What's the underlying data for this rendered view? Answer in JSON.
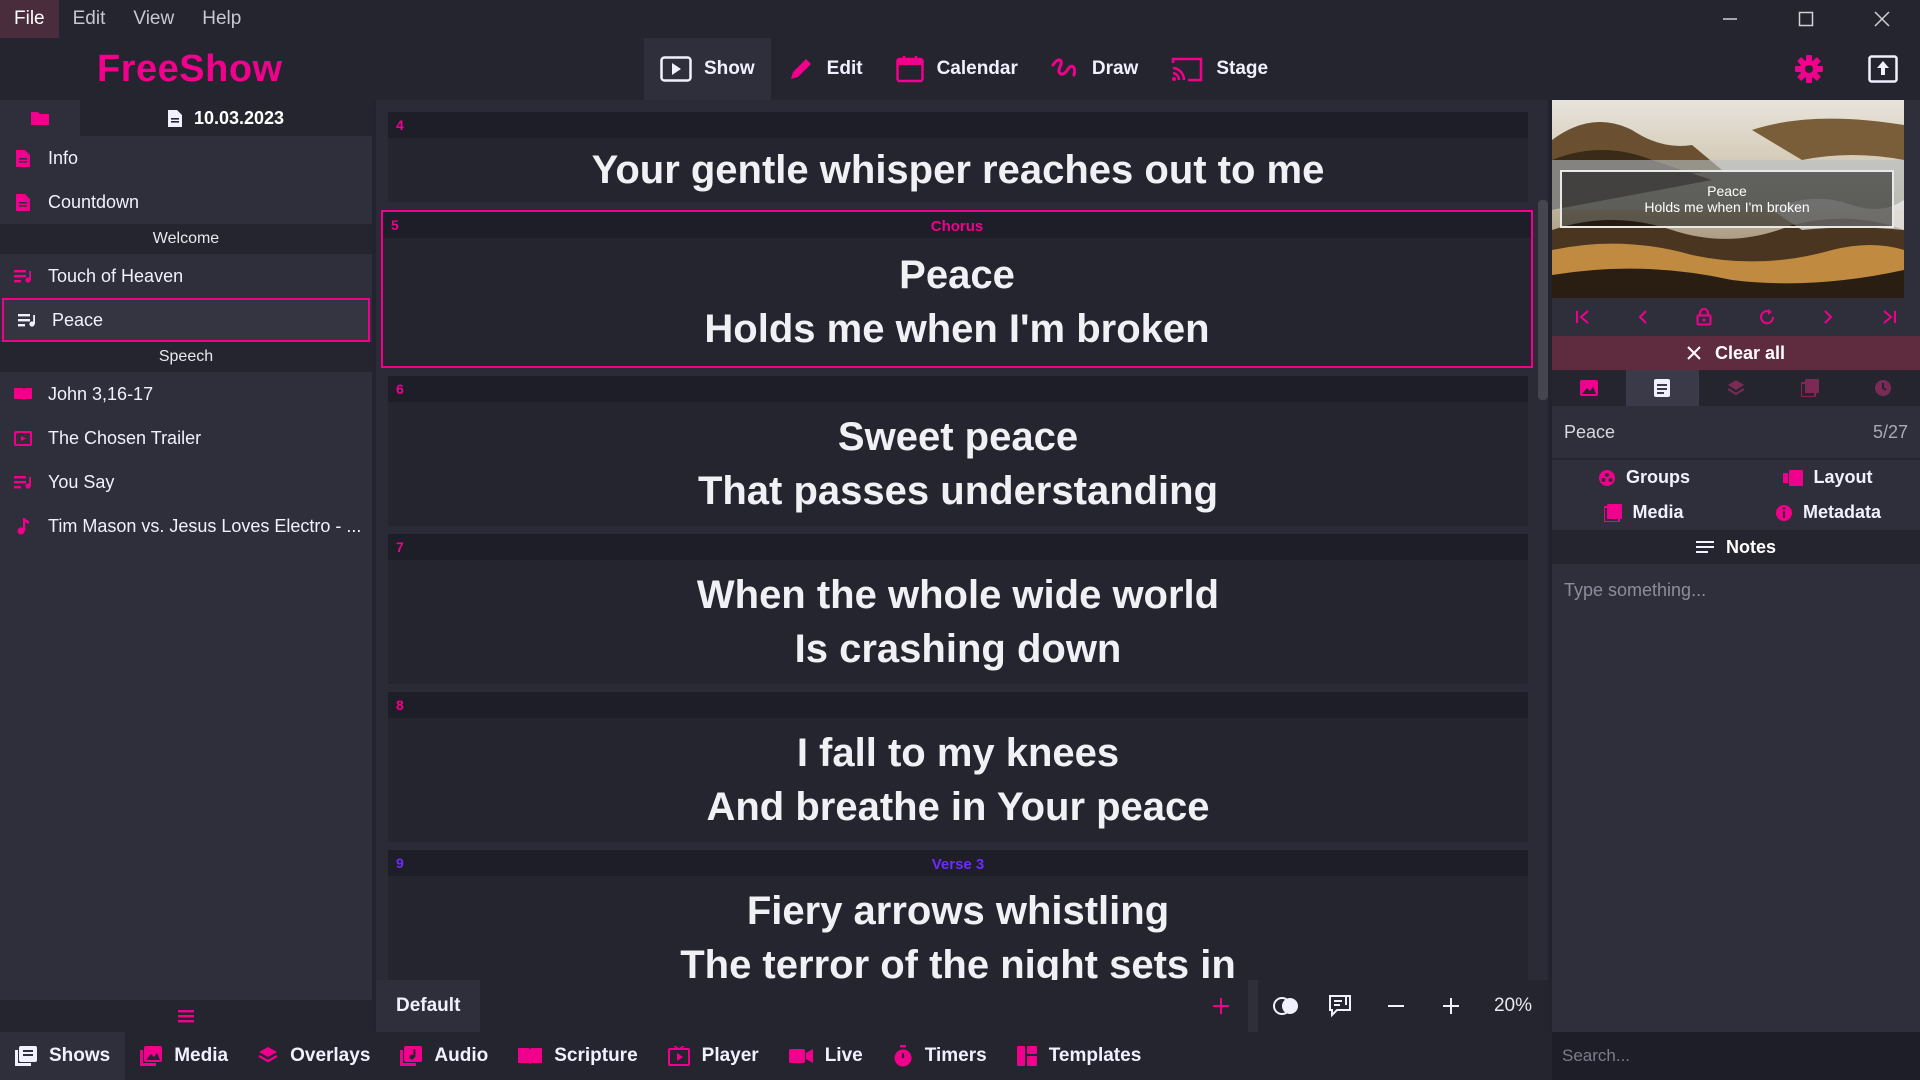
{
  "menu": [
    "File",
    "Edit",
    "View",
    "Help"
  ],
  "app": {
    "title": "FreeShow"
  },
  "colors": {
    "accent": "#f0008c",
    "verse": "#6c2bff"
  },
  "topnav": [
    {
      "label": "Show",
      "icon": "play-icon"
    },
    {
      "label": "Edit",
      "icon": "pencil-icon"
    },
    {
      "label": "Calendar",
      "icon": "calendar-icon"
    },
    {
      "label": "Draw",
      "icon": "draw-icon"
    },
    {
      "label": "Stage",
      "icon": "cast-icon"
    }
  ],
  "projects": {
    "date": "10.03.2023",
    "items": [
      {
        "label": "Info",
        "icon": "document-icon"
      },
      {
        "label": "Countdown",
        "icon": "document-icon"
      }
    ],
    "section1": "Welcome",
    "items2": [
      {
        "label": "Touch of Heaven",
        "icon": "lyrics-icon"
      },
      {
        "label": "Peace",
        "icon": "lyrics-icon"
      }
    ],
    "section2": "Speech",
    "items3": [
      {
        "label": "John 3,16-17",
        "icon": "book-icon"
      },
      {
        "label": "The Chosen Trailer",
        "icon": "video-icon"
      },
      {
        "label": "You Say",
        "icon": "lyrics-icon"
      },
      {
        "label": "Tim Mason vs. Jesus Loves Electro - ...",
        "icon": "music-icon"
      }
    ]
  },
  "slides": [
    {
      "num": "4",
      "group": "",
      "lines": [
        "Your gentle whisper reaches out to me"
      ]
    },
    {
      "num": "5",
      "group": "Chorus",
      "lines": [
        "Peace",
        "Holds me when I'm broken"
      ]
    },
    {
      "num": "6",
      "group": "",
      "lines": [
        "Sweet peace",
        "That passes understanding"
      ]
    },
    {
      "num": "7",
      "group": "",
      "lines": [
        "When the whole wide world",
        "Is crashing down"
      ]
    },
    {
      "num": "8",
      "group": "",
      "lines": [
        "I fall to my knees",
        "And breathe in Your peace"
      ]
    },
    {
      "num": "9",
      "group": "Verse 3",
      "lines": [
        "Fiery arrows whistling",
        "The terror of the night sets in"
      ]
    }
  ],
  "centerbar": {
    "layout": "Default",
    "zoom": "20%"
  },
  "output": {
    "lines": [
      "Peace",
      "Holds me when I'm broken"
    ]
  },
  "right": {
    "clear_all": "Clear all",
    "show_name": "Peace",
    "show_count": "5/27",
    "options": [
      "Groups",
      "Layout",
      "Media",
      "Metadata"
    ],
    "notes": "Notes",
    "notes_placeholder": "Type something..."
  },
  "bottom_tabs": [
    {
      "label": "Shows",
      "icon": "shows-icon"
    },
    {
      "label": "Media",
      "icon": "image-icon"
    },
    {
      "label": "Overlays",
      "icon": "layers-icon"
    },
    {
      "label": "Audio",
      "icon": "audio-icon"
    },
    {
      "label": "Scripture",
      "icon": "book-icon"
    },
    {
      "label": "Player",
      "icon": "player-icon"
    },
    {
      "label": "Live",
      "icon": "camera-icon"
    },
    {
      "label": "Timers",
      "icon": "timer-icon"
    },
    {
      "label": "Templates",
      "icon": "templates-icon"
    }
  ],
  "search": {
    "placeholder": "Search..."
  }
}
